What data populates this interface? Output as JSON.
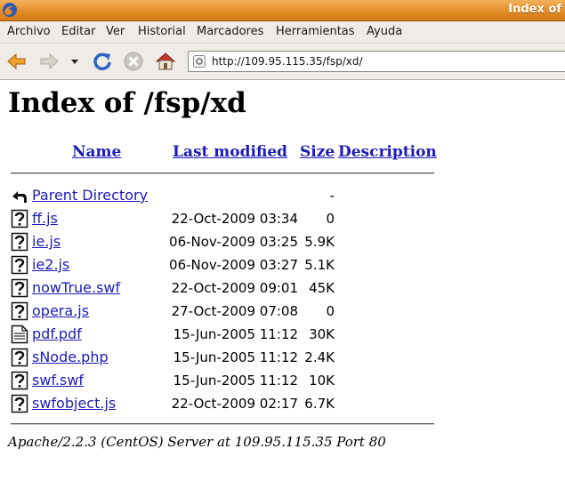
{
  "window": {
    "title": "Index of"
  },
  "menu": {
    "items": [
      "Archivo",
      "Editar",
      "Ver",
      "Historial",
      "Marcadores",
      "Herramientas",
      "Ayuda"
    ]
  },
  "toolbar": {
    "url": "http://109.95.115.35/fsp/xd/"
  },
  "page": {
    "heading": "Index of /fsp/xd",
    "columns": {
      "name": "Name",
      "last_modified": "Last modified",
      "size": "Size",
      "description": "Description"
    },
    "parent": {
      "name": "Parent Directory",
      "size": "-"
    },
    "files": [
      {
        "name": "ff.js",
        "date": "22-Oct-2009 03:34",
        "size": "0",
        "icon": "unknown-file-icon"
      },
      {
        "name": "ie.js",
        "date": "06-Nov-2009 03:25",
        "size": "5.9K",
        "icon": "unknown-file-icon"
      },
      {
        "name": "ie2.js",
        "date": "06-Nov-2009 03:27",
        "size": "5.1K",
        "icon": "unknown-file-icon"
      },
      {
        "name": "nowTrue.swf",
        "date": "22-Oct-2009 09:01",
        "size": "45K",
        "icon": "unknown-file-icon"
      },
      {
        "name": "opera.js",
        "date": "27-Oct-2009 07:08",
        "size": "0",
        "icon": "unknown-file-icon"
      },
      {
        "name": "pdf.pdf",
        "date": "15-Jun-2005 11:12",
        "size": "30K",
        "icon": "document-icon"
      },
      {
        "name": "sNode.php",
        "date": "15-Jun-2005 11:12",
        "size": "2.4K",
        "icon": "unknown-file-icon"
      },
      {
        "name": "swf.swf",
        "date": "15-Jun-2005 11:12",
        "size": "10K",
        "icon": "unknown-file-icon"
      },
      {
        "name": "swfobject.js",
        "date": "22-Oct-2009 02:17",
        "size": "6.7K",
        "icon": "unknown-file-icon"
      }
    ],
    "address": "Apache/2.2.3 (CentOS) Server at 109.95.115.35 Port 80"
  },
  "colors": {
    "titlebar": "#e08a24",
    "link": "#1c1cb8",
    "chrome": "#efebe7"
  }
}
